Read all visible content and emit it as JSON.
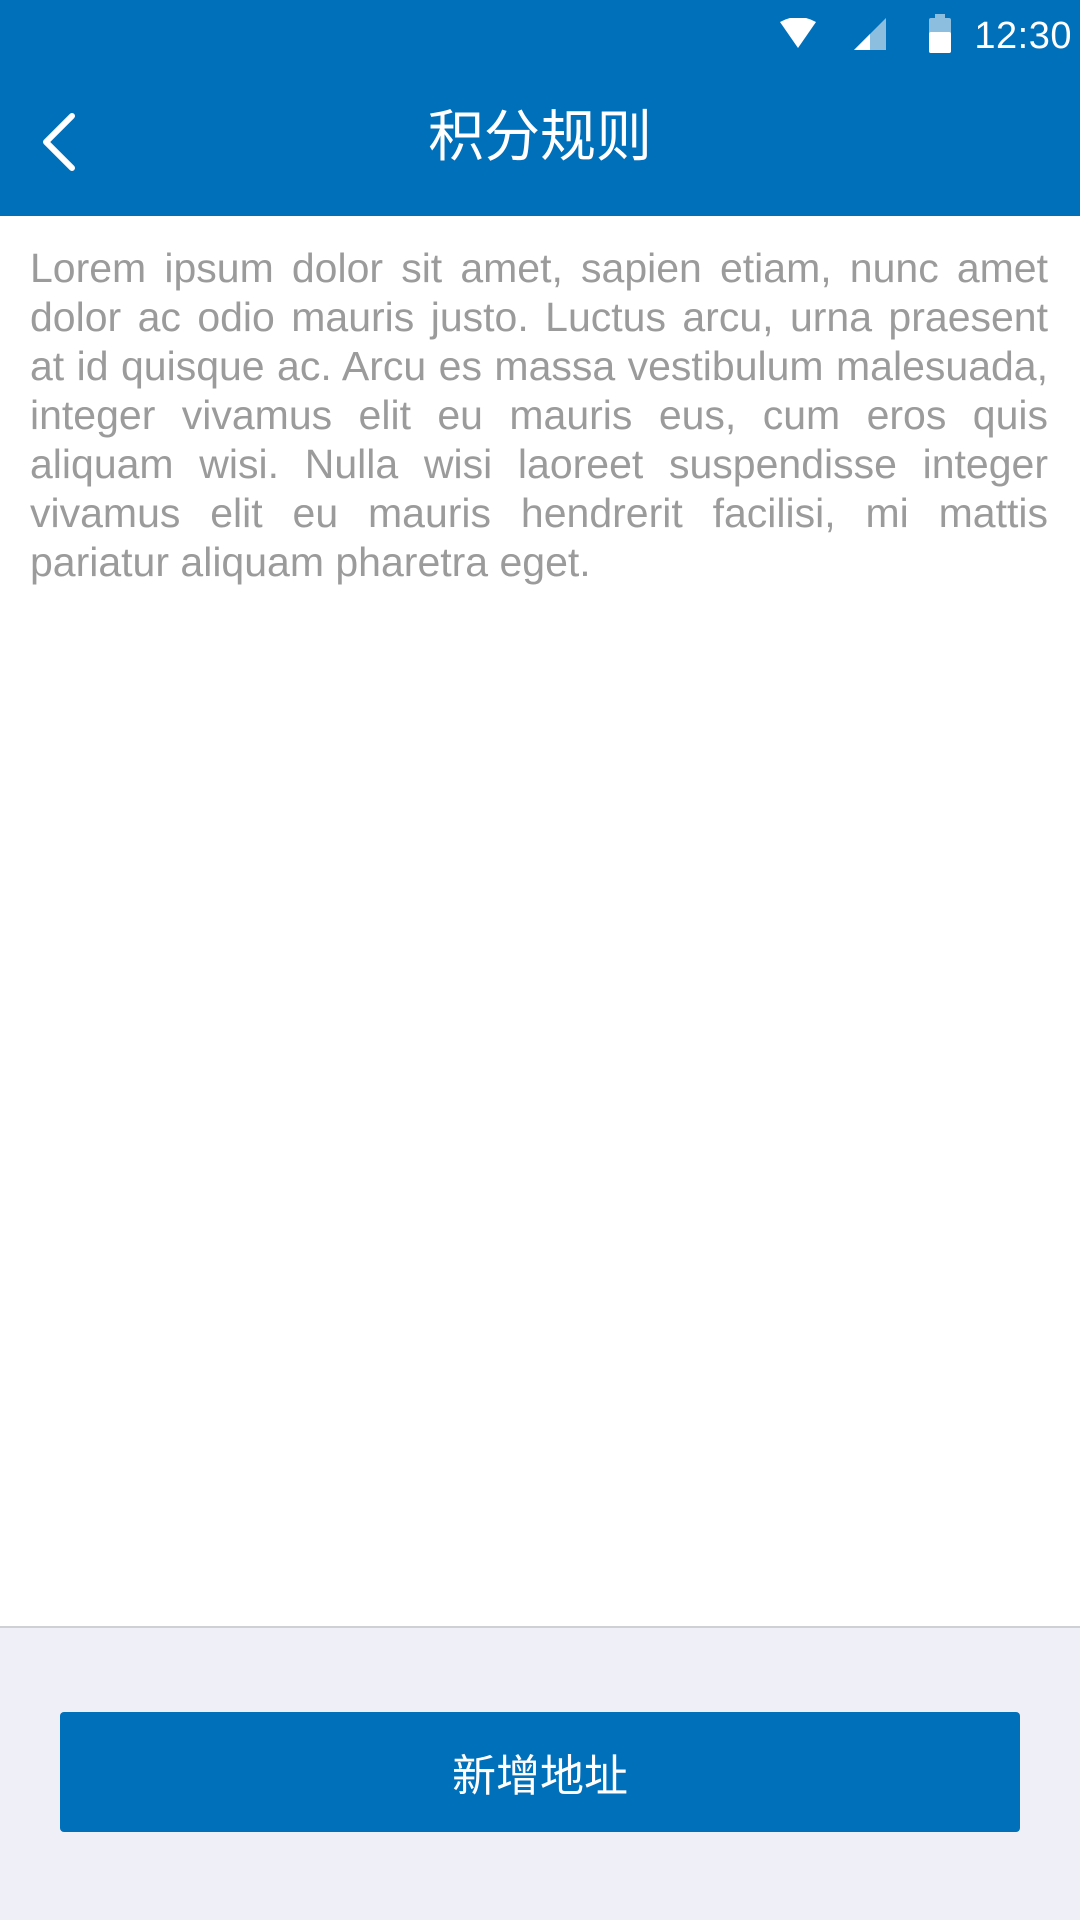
{
  "status_bar": {
    "time": "12:30",
    "icons": [
      "wifi-icon",
      "signal-icon",
      "battery-icon"
    ]
  },
  "app_bar": {
    "back_icon": "chevron-left-icon",
    "title": "积分规则"
  },
  "content": {
    "rules_text": "Lorem ipsum dolor sit amet, sapien etiam, nunc amet dolor ac odio mauris justo. Luctus arcu, urna praesent at id quisque ac. Arcu es massa vestibulum malesuada, integer vivamus elit eu mauris eus, cum eros quis aliquam wisi. Nulla wisi laoreet suspendisse integer vivamus elit eu mauris hendrerit facilisi, mi mattis pariatur aliquam pharetra eget."
  },
  "footer": {
    "add_address_label": "新增地址"
  },
  "colors": {
    "primary": "#0070bb",
    "body_text": "#9b9b9b",
    "footer_bg": "#efeff7"
  }
}
